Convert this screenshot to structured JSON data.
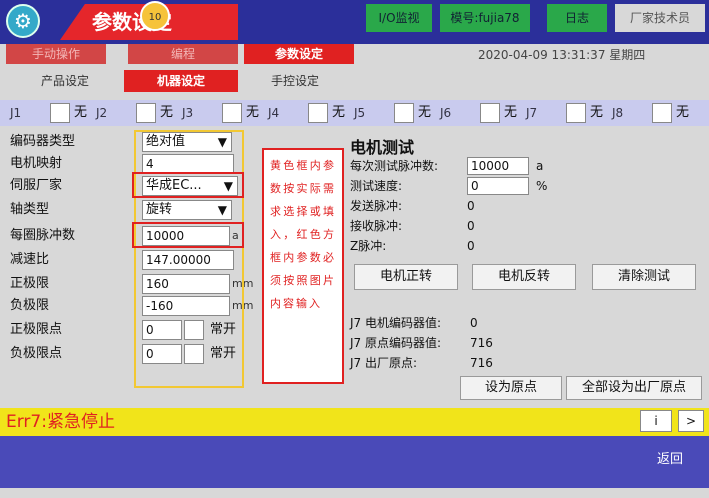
{
  "top": {
    "title": "参数设定",
    "title_badge": "10",
    "io_monitor": "I/O监视",
    "model": "模号:fujia78",
    "log": "日志",
    "user": "厂家技术员"
  },
  "nav": {
    "manual": "手动操作",
    "edit": "编程",
    "param": "参数设定",
    "datetime": "2020-04-09 13:31:37 星期四"
  },
  "subtabs": {
    "product": "产品设定",
    "machine": "机器设定",
    "handctrl": "手控设定"
  },
  "joints": [
    {
      "label": "J1",
      "value": "无"
    },
    {
      "label": "J2",
      "value": "无"
    },
    {
      "label": "J3",
      "value": "无"
    },
    {
      "label": "J4",
      "value": "无"
    },
    {
      "label": "J5",
      "value": "无"
    },
    {
      "label": "J6",
      "value": "无"
    },
    {
      "label": "J7",
      "value": "无"
    },
    {
      "label": "J8",
      "value": "无"
    }
  ],
  "params": {
    "encoder_type_label": "编码器类型",
    "encoder_type_value": "绝对值",
    "motor_map_label": "电机映射",
    "motor_map_value": "4",
    "servo_vendor_label": "伺服厂家",
    "servo_vendor_value": "华成EC...",
    "axis_type_label": "轴类型",
    "axis_type_value": "旋转",
    "pulses_label": "每圈脉冲数",
    "pulses_value": "10000",
    "pulses_unit": "a",
    "ratio_label": "减速比",
    "ratio_value": "147.00000",
    "pos_limit_label": "正极限",
    "pos_limit_value": "160",
    "pos_limit_unit": "mm",
    "neg_limit_label": "负极限",
    "neg_limit_value": "-160",
    "neg_limit_unit": "mm",
    "pos_limit_point_label": "正极限点",
    "pos_limit_point_value": "0",
    "pos_limit_point_state": "常开",
    "neg_limit_point_label": "负极限点",
    "neg_limit_point_value": "0",
    "neg_limit_point_state": "常开"
  },
  "note": "黄色框内参数按实际需求选择或填入，红色方框内参数必须按照图片内容输入",
  "motor_test": {
    "title": "电机测试",
    "pulse_label": "每次测试脉冲数:",
    "pulse_value": "10000",
    "pulse_unit": "a",
    "speed_label": "测试速度:",
    "speed_value": "0",
    "speed_unit": "%",
    "sent_label": "发送脉冲:",
    "sent_value": "0",
    "recv_label": "接收脉冲:",
    "recv_value": "0",
    "z_label": "Z脉冲:",
    "z_value": "0",
    "btn_forward": "电机正转",
    "btn_reverse": "电机反转",
    "btn_clear": "清除测试"
  },
  "encoder_info": {
    "motor_enc_label": "J7 电机编码器值:",
    "motor_enc_value": "0",
    "origin_enc_label": "J7 原点编码器值:",
    "origin_enc_value": "716",
    "factory_label": "J7 出厂原点:",
    "factory_value": "716",
    "btn_set_origin": "设为原点",
    "btn_set_all_factory": "全部设为出厂原点"
  },
  "status": {
    "error": "Err7:紧急停止",
    "btn_info": "i",
    "btn_next": ">",
    "btn_back": "返回"
  },
  "colors": {
    "top_bar": "#2b2f9a",
    "active_tab": "#e02121",
    "joint_bar": "#c9cbee",
    "error_bar": "#f1e41a",
    "bottom_bar": "#4a4ab8"
  }
}
